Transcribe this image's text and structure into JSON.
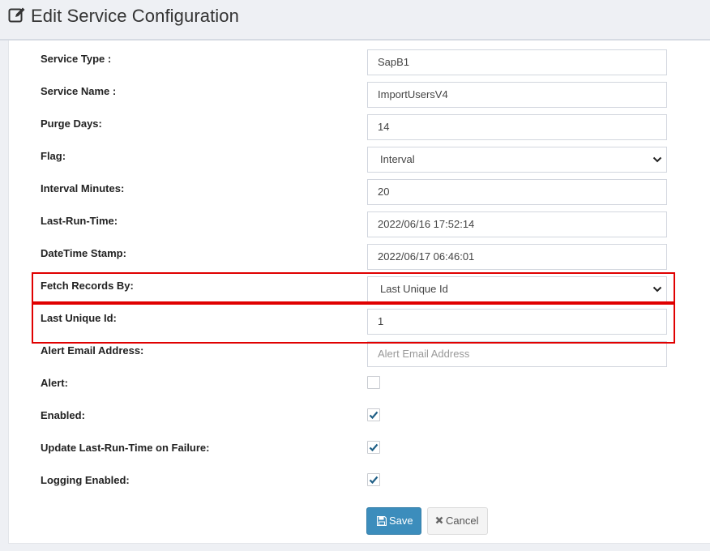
{
  "header": {
    "title": "Edit Service Configuration",
    "icon": "edit-icon"
  },
  "form": {
    "service_type": {
      "label": "Service Type :",
      "value": "SapB1"
    },
    "service_name": {
      "label": "Service Name :",
      "value": "ImportUsersV4"
    },
    "purge_days": {
      "label": "Purge Days:",
      "value": "14"
    },
    "flag": {
      "label": "Flag:",
      "value": "Interval"
    },
    "interval_minutes": {
      "label": "Interval Minutes:",
      "value": "20"
    },
    "last_run_time": {
      "label": "Last-Run-Time:",
      "value": "2022/06/16 17:52:14"
    },
    "datetime_stamp": {
      "label": "DateTime Stamp:",
      "value": "2022/06/17 06:46:01"
    },
    "fetch_records_by": {
      "label": "Fetch Records By:",
      "value": "Last Unique Id"
    },
    "last_unique_id": {
      "label": "Last Unique Id:",
      "value": "1"
    },
    "alert_email": {
      "label": "Alert Email Address:",
      "value": "",
      "placeholder": "Alert Email Address"
    },
    "alert": {
      "label": "Alert:",
      "checked": false
    },
    "enabled": {
      "label": "Enabled:",
      "checked": true
    },
    "update_on_failure": {
      "label": "Update Last-Run-Time on Failure:",
      "checked": true
    },
    "logging_enabled": {
      "label": "Logging Enabled:",
      "checked": true
    }
  },
  "buttons": {
    "save_label": "Save",
    "cancel_label": "Cancel"
  },
  "colors": {
    "primary": "#3c8dbc",
    "highlight": "#e00000",
    "checkmark": "#1f5f86"
  }
}
